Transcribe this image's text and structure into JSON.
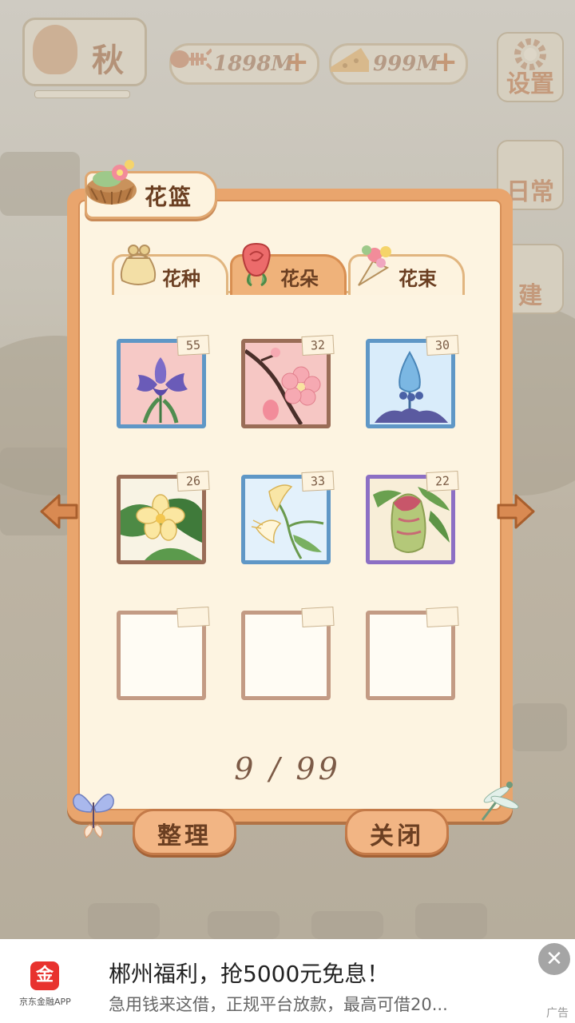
{
  "hud": {
    "season": "秋",
    "fish_amount": "1898M",
    "cheese_amount": "999M",
    "settings_label": "设置",
    "side_daily_label": "日常",
    "side_build_label": "建"
  },
  "panel": {
    "title": "花篮",
    "tabs": [
      {
        "label": "花种",
        "icon": "seed-bag-icon"
      },
      {
        "label": "花朵",
        "icon": "rose-icon"
      },
      {
        "label": "花束",
        "icon": "bouquet-icon"
      }
    ],
    "active_tab": "花朵",
    "slots": [
      {
        "count": "55",
        "item": "purple-iris",
        "frame": "blue"
      },
      {
        "count": "32",
        "item": "cherry-blossom",
        "frame": "brown"
      },
      {
        "count": "30",
        "item": "blue-bud",
        "frame": "blue"
      },
      {
        "count": "26",
        "item": "plumeria",
        "frame": "brown"
      },
      {
        "count": "33",
        "item": "honeysuckle",
        "frame": "blue"
      },
      {
        "count": "22",
        "item": "pitcher-plant",
        "frame": "purple"
      },
      {
        "count": "",
        "item": "",
        "frame": "empty"
      },
      {
        "count": "",
        "item": "",
        "frame": "empty"
      },
      {
        "count": "",
        "item": "",
        "frame": "empty"
      }
    ],
    "capacity": "9 / 99",
    "sort_button": "整理",
    "close_button": "关闭"
  },
  "ad": {
    "app_name": "京东金融APP",
    "title": "郴州福利，抢5000元免息！",
    "subtitle": "急用钱来这借，正规平台放款，最高可借20...",
    "tag": "广告",
    "close_icon": "close-icon"
  },
  "colors": {
    "panel_orange": "#e9a56d",
    "panel_cream": "#fdf4e1",
    "text_brown": "#6b3f22",
    "frame_blue": "#5f97c6",
    "frame_purple": "#8c6fc4"
  }
}
